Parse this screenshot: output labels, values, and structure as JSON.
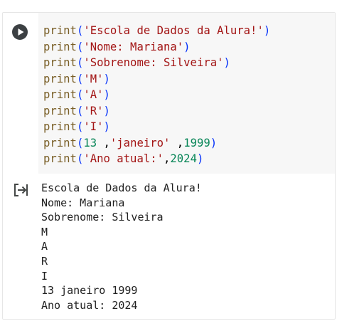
{
  "cell": {
    "run_icon": "play-icon",
    "output_icon": "output-redirect-icon",
    "code_lines": [
      [
        {
          "t": "fn",
          "v": "print"
        },
        {
          "t": "paren",
          "v": "("
        },
        {
          "t": "str",
          "v": "'Escola de Dados da Alura!'"
        },
        {
          "t": "paren",
          "v": ")"
        }
      ],
      [
        {
          "t": "fn",
          "v": "print"
        },
        {
          "t": "paren",
          "v": "("
        },
        {
          "t": "str",
          "v": "'Nome: Mariana'"
        },
        {
          "t": "paren",
          "v": ")"
        }
      ],
      [
        {
          "t": "fn",
          "v": "print"
        },
        {
          "t": "paren",
          "v": "("
        },
        {
          "t": "str",
          "v": "'Sobrenome: Silveira'"
        },
        {
          "t": "paren",
          "v": ")"
        }
      ],
      [
        {
          "t": "fn",
          "v": "print"
        },
        {
          "t": "paren",
          "v": "("
        },
        {
          "t": "str",
          "v": "'M'"
        },
        {
          "t": "paren",
          "v": ")"
        }
      ],
      [
        {
          "t": "fn",
          "v": "print"
        },
        {
          "t": "paren",
          "v": "("
        },
        {
          "t": "str",
          "v": "'A'"
        },
        {
          "t": "paren",
          "v": ")"
        }
      ],
      [
        {
          "t": "fn",
          "v": "print"
        },
        {
          "t": "paren",
          "v": "("
        },
        {
          "t": "str",
          "v": "'R'"
        },
        {
          "t": "paren",
          "v": ")"
        }
      ],
      [
        {
          "t": "fn",
          "v": "print"
        },
        {
          "t": "paren",
          "v": "("
        },
        {
          "t": "str",
          "v": "'I'"
        },
        {
          "t": "paren",
          "v": ")"
        }
      ],
      [
        {
          "t": "fn",
          "v": "print"
        },
        {
          "t": "paren",
          "v": "("
        },
        {
          "t": "num",
          "v": "13"
        },
        {
          "t": "punct",
          "v": " ,"
        },
        {
          "t": "str",
          "v": "'janeiro'"
        },
        {
          "t": "punct",
          "v": " ,"
        },
        {
          "t": "num",
          "v": "1999"
        },
        {
          "t": "paren",
          "v": ")"
        }
      ],
      [
        {
          "t": "fn",
          "v": "print"
        },
        {
          "t": "paren",
          "v": "("
        },
        {
          "t": "str",
          "v": "'Ano atual:'"
        },
        {
          "t": "punct",
          "v": ","
        },
        {
          "t": "num",
          "v": "2024"
        },
        {
          "t": "paren",
          "v": ")"
        }
      ]
    ],
    "output_lines": [
      "Escola de Dados da Alura!",
      "Nome: Mariana",
      "Sobrenome: Silveira",
      "M",
      "A",
      "R",
      "I",
      "13 janeiro 1999",
      "Ano atual: 2024"
    ]
  },
  "colors": {
    "function": "#795e26",
    "paren": "#0431fa",
    "string": "#a31515",
    "number": "#098658",
    "code_background": "#f7f7f7",
    "output_text": "#212121"
  }
}
